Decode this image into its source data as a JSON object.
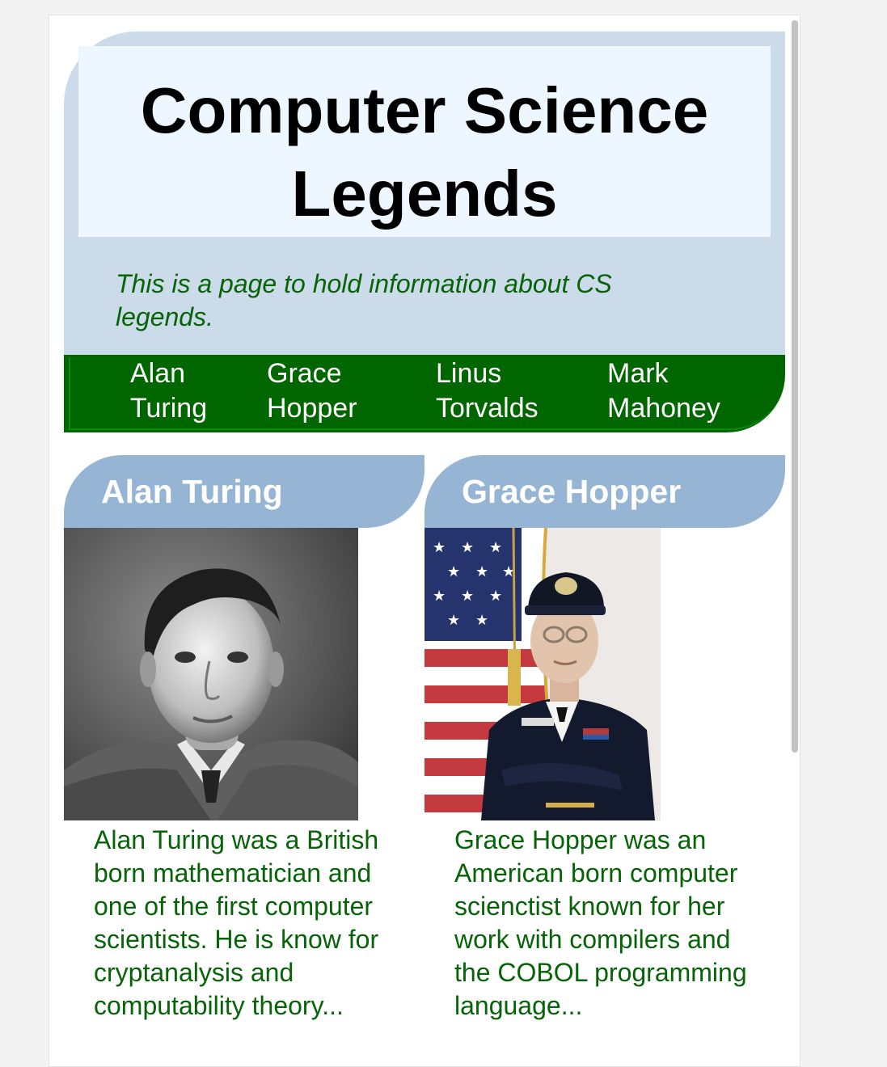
{
  "header": {
    "title": "Computer Science Legends",
    "tagline": "This is a page to hold information about CS legends."
  },
  "nav": {
    "items": [
      {
        "label_line1": "Alan",
        "label_line2": "Turing"
      },
      {
        "label_line1": "Grace",
        "label_line2": "Hopper"
      },
      {
        "label_line1": "Linus",
        "label_line2": "Torvalds"
      },
      {
        "label_line1": "Mark",
        "label_line2": "Mahoney"
      }
    ]
  },
  "cards": [
    {
      "name": "Alan Turing",
      "photo_alt": "Alan Turing",
      "description": "Alan Turing was a British born mathematician and one of the first computer scientists. He is know for cryptanalysis and computability theory..."
    },
    {
      "name": "Grace Hopper",
      "photo_alt": "Grace Hopper",
      "description": "Grace Hopper was an American born computer scienctist known for her work with compilers and the COBOL programming language..."
    }
  ],
  "colors": {
    "page_background": "#f3f3f4",
    "header_background": "#cbdbea",
    "title_box_background": "#eef6ff",
    "nav_background": "#006600",
    "card_header_background": "#96b4d4",
    "body_text_green": "#076307"
  }
}
